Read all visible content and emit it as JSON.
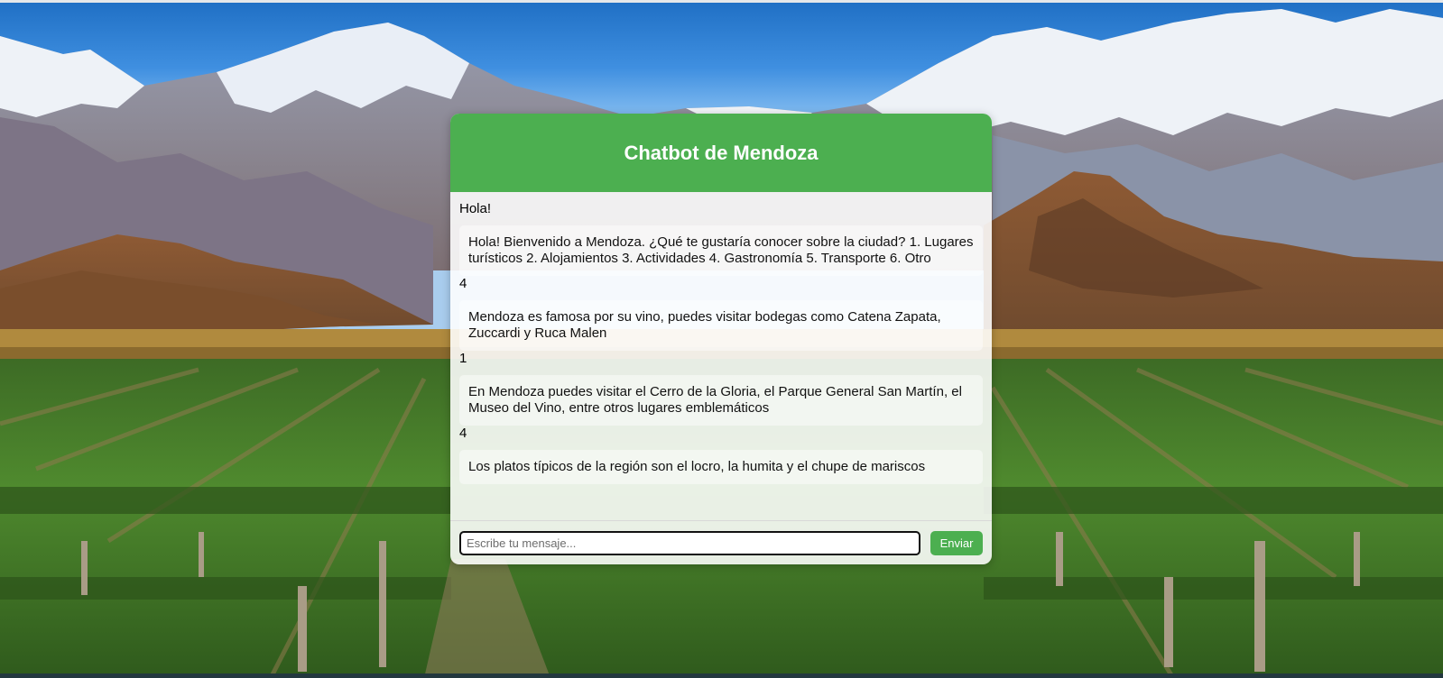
{
  "chat": {
    "title": "Chatbot de Mendoza",
    "messages": [
      {
        "from": "user",
        "text": "Hola!"
      },
      {
        "from": "bot",
        "text": "Hola! Bienvenido a Mendoza. ¿Qué te gustaría conocer sobre la ciudad? 1. Lugares turísticos 2. Alojamientos 3. Actividades 4. Gastronomía 5. Transporte 6. Otro"
      },
      {
        "from": "user",
        "text": "4"
      },
      {
        "from": "bot",
        "text": "Mendoza es famosa por su vino, puedes visitar bodegas como Catena Zapata, Zuccardi y Ruca Malen"
      },
      {
        "from": "user",
        "text": "1"
      },
      {
        "from": "bot",
        "text": "En Mendoza puedes visitar el Cerro de la Gloria, el Parque General San Martín, el Museo del Vino, entre otros lugares emblemáticos"
      },
      {
        "from": "user",
        "text": "4"
      },
      {
        "from": "bot",
        "text": "Los platos típicos de la región son el locro, la humita y el chupe de mariscos"
      }
    ],
    "input": {
      "placeholder": "Escribe tu mensaje...",
      "value": ""
    },
    "send_label": "Enviar"
  },
  "colors": {
    "accent": "#4caf50",
    "input_border": "#111111"
  },
  "background": {
    "icon": "mountain-vineyard-landscape"
  }
}
